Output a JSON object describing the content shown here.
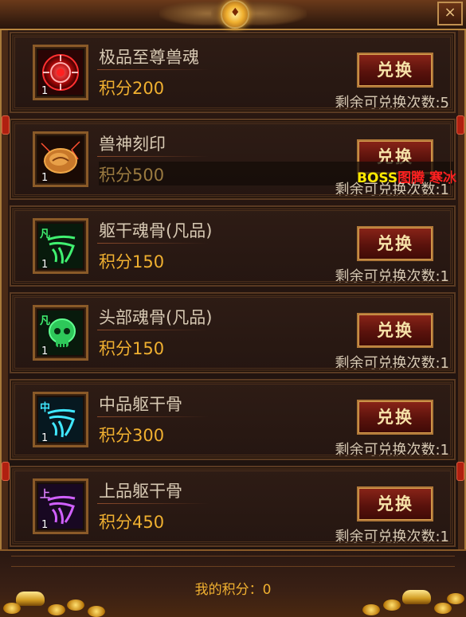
{
  "window": {
    "close_icon": "×"
  },
  "items": [
    {
      "name": "极品至尊兽魂",
      "score_label": "积分200",
      "qty": "1",
      "tier": "",
      "button_label": "兑换",
      "remaining_label": "剩余可兑换次数:5",
      "icon": "red-orb-icon",
      "color": "#d01818"
    },
    {
      "name": "兽神刻印",
      "score_label": "积分500",
      "qty": "1",
      "tier": "",
      "button_label": "兑换",
      "remaining_label": "剩余可兑换次数:1",
      "icon": "seal-stone-icon",
      "color": "#e88a20"
    },
    {
      "name": "躯干魂骨(凡品)",
      "score_label": "积分150",
      "qty": "1",
      "tier": "凡",
      "button_label": "兑换",
      "remaining_label": "剩余可兑换次数:1",
      "icon": "green-torso-bone-icon",
      "color": "#38e05a"
    },
    {
      "name": "头部魂骨(凡品)",
      "score_label": "积分150",
      "qty": "1",
      "tier": "凡",
      "button_label": "兑换",
      "remaining_label": "剩余可兑换次数:1",
      "icon": "green-skull-icon",
      "color": "#38e05a"
    },
    {
      "name": "中品躯干骨",
      "score_label": "积分300",
      "qty": "1",
      "tier": "中",
      "button_label": "兑换",
      "remaining_label": "剩余可兑换次数:1",
      "icon": "cyan-torso-bone-icon",
      "color": "#30d8f0"
    },
    {
      "name": "上品躯干骨",
      "score_label": "积分450",
      "qty": "1",
      "tier": "上",
      "button_label": "兑换",
      "remaining_label": "剩余可兑换次数:1",
      "icon": "purple-torso-bone-icon",
      "color": "#c040ff"
    }
  ],
  "overlay": {
    "boss_a": "BOSS",
    "boss_b": "图腾  寒冰"
  },
  "footer": {
    "my_score_label": "我的积分：0"
  }
}
